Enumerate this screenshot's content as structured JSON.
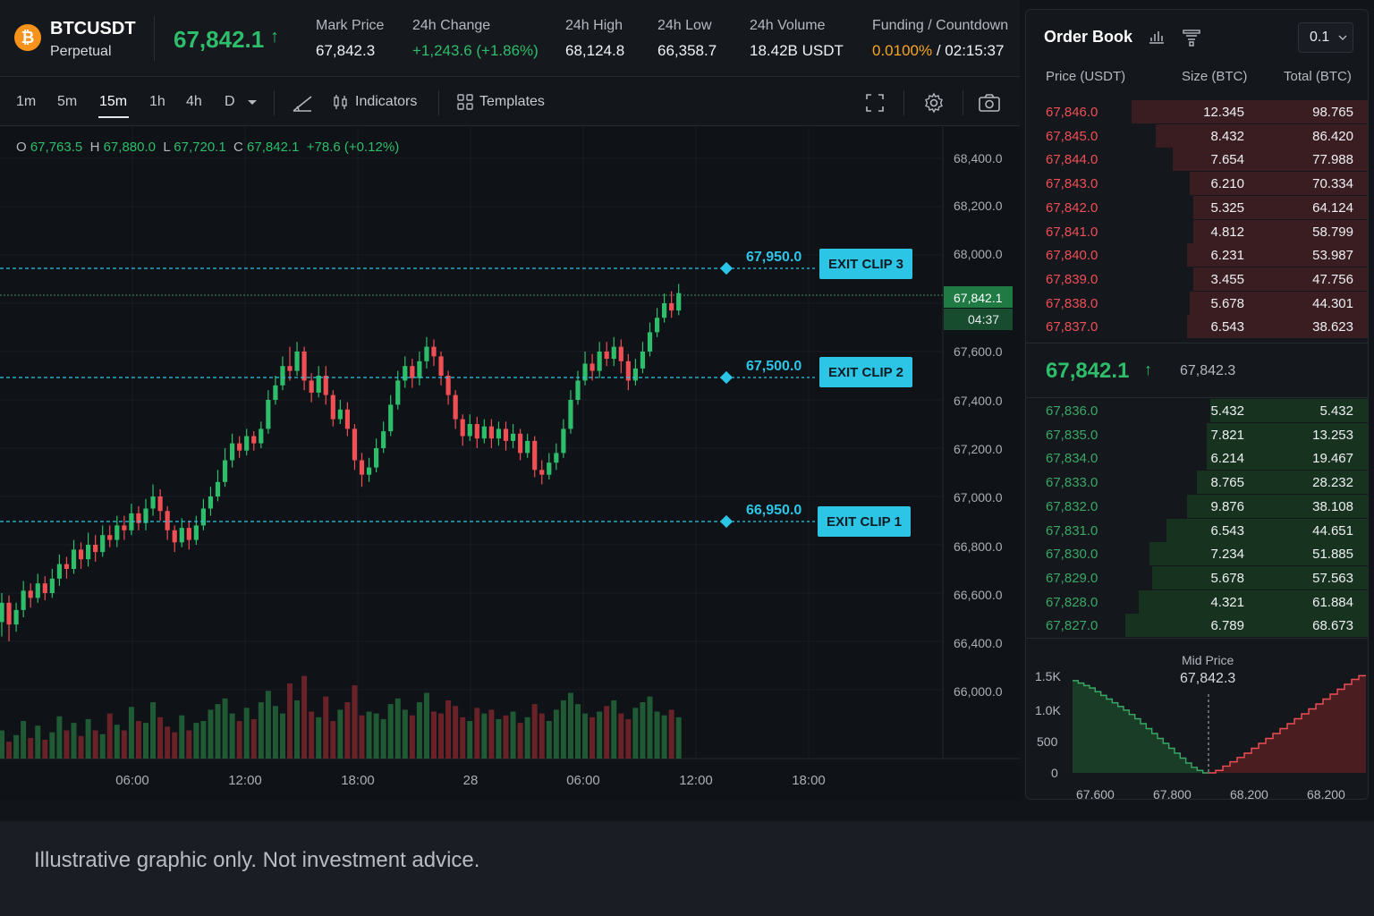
{
  "header": {
    "coin_glyph": "₿",
    "symbol": "BTCUSDT",
    "contract": "Perpetual",
    "last_price": "67,842.1",
    "arrow": "↑",
    "stats": [
      {
        "label": "Mark Price",
        "value": "67,842.3",
        "tone": "default"
      },
      {
        "label": "24h Change",
        "value": "+1,243.6 (+1.86%)",
        "tone": "green"
      },
      {
        "label": "24h High",
        "value": "68,124.8",
        "tone": "default"
      },
      {
        "label": "24h Low",
        "value": "66,358.7",
        "tone": "default"
      },
      {
        "label": "24h Volume",
        "value": "18.42B USDT",
        "tone": "default"
      }
    ],
    "funding": {
      "label": "Funding / Countdown",
      "rate": "0.0100%",
      "sep": " / ",
      "countdown": "02:15:37"
    }
  },
  "toolbar": {
    "timeframes": [
      "1m",
      "5m",
      "15m",
      "1h",
      "4h",
      "D"
    ],
    "active": "15m",
    "dropdown_icon": "caret-down-icon",
    "indicators_label": "Indicators",
    "templates_label": "Templates"
  },
  "ohlc": {
    "o_label": "O",
    "o": "67,763.5",
    "h_label": "H",
    "h": "67,880.0",
    "l_label": "L",
    "l": "67,720.1",
    "c_label": "C",
    "c": "67,842.1",
    "chg": "+78.6 (+0.12%)"
  },
  "chart": {
    "y_ticks": [
      "68,400.0",
      "68,200.0",
      "68,000.0",
      "67,600.0",
      "67,400.0",
      "67,200.0",
      "67,000.0",
      "66,800.0",
      "66,600.0",
      "66,400.0",
      "66,000.0"
    ],
    "x_ticks": [
      "06:00",
      "12:00",
      "18:00",
      "28",
      "06:00",
      "12:00",
      "18:00"
    ],
    "current_price": "67,842.1",
    "candle_countdown": "04:37",
    "exits": [
      {
        "label": "EXIT CLIP 3",
        "price": "67,950.0"
      },
      {
        "label": "EXIT CLIP 2",
        "price": "67,500.0"
      },
      {
        "label": "EXIT CLIP 1",
        "price": "66,950.0"
      }
    ],
    "colors": {
      "up": "#2ebd6b",
      "down": "#ef4f55",
      "accent": "#2dc5e6"
    }
  },
  "chart_data": {
    "type": "candlestick",
    "x_ticks": [
      "06:00",
      "12:00",
      "18:00",
      "28",
      "06:00",
      "12:00",
      "18:00"
    ],
    "candles": [
      {
        "o": 66480,
        "c": 66560,
        "h": 66600,
        "l": 66420
      },
      {
        "o": 66560,
        "c": 66470,
        "h": 66590,
        "l": 66400
      },
      {
        "o": 66470,
        "c": 66530,
        "h": 66560,
        "l": 66440
      },
      {
        "o": 66530,
        "c": 66610,
        "h": 66650,
        "l": 66500
      },
      {
        "o": 66610,
        "c": 66580,
        "h": 66640,
        "l": 66540
      },
      {
        "o": 66580,
        "c": 66640,
        "h": 66680,
        "l": 66560
      },
      {
        "o": 66640,
        "c": 66600,
        "h": 66670,
        "l": 66570
      },
      {
        "o": 66600,
        "c": 66660,
        "h": 66700,
        "l": 66580
      },
      {
        "o": 66660,
        "c": 66720,
        "h": 66760,
        "l": 66630
      },
      {
        "o": 66720,
        "c": 66700,
        "h": 66750,
        "l": 66660
      },
      {
        "o": 66700,
        "c": 66780,
        "h": 66820,
        "l": 66680
      },
      {
        "o": 66780,
        "c": 66740,
        "h": 66810,
        "l": 66700
      },
      {
        "o": 66740,
        "c": 66800,
        "h": 66850,
        "l": 66710
      },
      {
        "o": 66800,
        "c": 66770,
        "h": 66840,
        "l": 66730
      },
      {
        "o": 66770,
        "c": 66840,
        "h": 66880,
        "l": 66750
      },
      {
        "o": 66840,
        "c": 66820,
        "h": 66880,
        "l": 66790
      },
      {
        "o": 66820,
        "c": 66880,
        "h": 66920,
        "l": 66790
      },
      {
        "o": 66880,
        "c": 66860,
        "h": 66920,
        "l": 66820
      },
      {
        "o": 66860,
        "c": 66930,
        "h": 66970,
        "l": 66840
      },
      {
        "o": 66930,
        "c": 66890,
        "h": 66960,
        "l": 66860
      },
      {
        "o": 66890,
        "c": 66950,
        "h": 66990,
        "l": 66860
      },
      {
        "o": 66950,
        "c": 67000,
        "h": 67050,
        "l": 66920
      },
      {
        "o": 67000,
        "c": 66940,
        "h": 67030,
        "l": 66900
      },
      {
        "o": 66940,
        "c": 66860,
        "h": 66960,
        "l": 66820
      },
      {
        "o": 66860,
        "c": 66810,
        "h": 66880,
        "l": 66770
      },
      {
        "o": 66810,
        "c": 66870,
        "h": 66910,
        "l": 66790
      },
      {
        "o": 66870,
        "c": 66820,
        "h": 66900,
        "l": 66780
      },
      {
        "o": 66820,
        "c": 66880,
        "h": 66920,
        "l": 66800
      },
      {
        "o": 66880,
        "c": 66950,
        "h": 66990,
        "l": 66860
      },
      {
        "o": 66950,
        "c": 67000,
        "h": 67040,
        "l": 66920
      },
      {
        "o": 67000,
        "c": 67060,
        "h": 67110,
        "l": 66980
      },
      {
        "o": 67060,
        "c": 67150,
        "h": 67200,
        "l": 67040
      },
      {
        "o": 67150,
        "c": 67220,
        "h": 67260,
        "l": 67120
      },
      {
        "o": 67220,
        "c": 67190,
        "h": 67250,
        "l": 67160
      },
      {
        "o": 67190,
        "c": 67250,
        "h": 67280,
        "l": 67170
      },
      {
        "o": 67250,
        "c": 67220,
        "h": 67270,
        "l": 67190
      },
      {
        "o": 67220,
        "c": 67280,
        "h": 67310,
        "l": 67200
      },
      {
        "o": 67280,
        "c": 67400,
        "h": 67440,
        "l": 67260
      },
      {
        "o": 67400,
        "c": 67460,
        "h": 67500,
        "l": 67380
      },
      {
        "o": 67460,
        "c": 67540,
        "h": 67580,
        "l": 67440
      },
      {
        "o": 67540,
        "c": 67520,
        "h": 67620,
        "l": 67480
      },
      {
        "o": 67520,
        "c": 67600,
        "h": 67640,
        "l": 67500
      },
      {
        "o": 67600,
        "c": 67480,
        "h": 67620,
        "l": 67440
      },
      {
        "o": 67480,
        "c": 67430,
        "h": 67510,
        "l": 67390
      },
      {
        "o": 67430,
        "c": 67500,
        "h": 67540,
        "l": 67410
      },
      {
        "o": 67500,
        "c": 67420,
        "h": 67540,
        "l": 67380
      },
      {
        "o": 67420,
        "c": 67320,
        "h": 67440,
        "l": 67290
      },
      {
        "o": 67320,
        "c": 67360,
        "h": 67400,
        "l": 67300
      },
      {
        "o": 67360,
        "c": 67280,
        "h": 67390,
        "l": 67250
      },
      {
        "o": 67280,
        "c": 67150,
        "h": 67300,
        "l": 67110
      },
      {
        "o": 67150,
        "c": 67090,
        "h": 67180,
        "l": 67040
      },
      {
        "o": 67090,
        "c": 67120,
        "h": 67160,
        "l": 67060
      },
      {
        "o": 67120,
        "c": 67200,
        "h": 67240,
        "l": 67100
      },
      {
        "o": 67200,
        "c": 67270,
        "h": 67310,
        "l": 67180
      },
      {
        "o": 67270,
        "c": 67380,
        "h": 67420,
        "l": 67250
      },
      {
        "o": 67380,
        "c": 67480,
        "h": 67520,
        "l": 67360
      },
      {
        "o": 67480,
        "c": 67540,
        "h": 67580,
        "l": 67450
      },
      {
        "o": 67540,
        "c": 67490,
        "h": 67570,
        "l": 67450
      },
      {
        "o": 67490,
        "c": 67560,
        "h": 67600,
        "l": 67460
      },
      {
        "o": 67560,
        "c": 67620,
        "h": 67660,
        "l": 67530
      },
      {
        "o": 67620,
        "c": 67580,
        "h": 67650,
        "l": 67540
      },
      {
        "o": 67580,
        "c": 67500,
        "h": 67600,
        "l": 67460
      },
      {
        "o": 67500,
        "c": 67420,
        "h": 67520,
        "l": 67380
      },
      {
        "o": 67420,
        "c": 67320,
        "h": 67440,
        "l": 67280
      },
      {
        "o": 67320,
        "c": 67250,
        "h": 67340,
        "l": 67210
      },
      {
        "o": 67250,
        "c": 67300,
        "h": 67340,
        "l": 67230
      },
      {
        "o": 67300,
        "c": 67240,
        "h": 67330,
        "l": 67200
      },
      {
        "o": 67240,
        "c": 67290,
        "h": 67320,
        "l": 67220
      },
      {
        "o": 67290,
        "c": 67240,
        "h": 67320,
        "l": 67200
      },
      {
        "o": 67240,
        "c": 67280,
        "h": 67310,
        "l": 67210
      },
      {
        "o": 67280,
        "c": 67230,
        "h": 67310,
        "l": 67190
      },
      {
        "o": 67230,
        "c": 67260,
        "h": 67300,
        "l": 67200
      },
      {
        "o": 67260,
        "c": 67180,
        "h": 67280,
        "l": 67150
      },
      {
        "o": 67180,
        "c": 67230,
        "h": 67260,
        "l": 67160
      },
      {
        "o": 67230,
        "c": 67110,
        "h": 67250,
        "l": 67080
      },
      {
        "o": 67110,
        "c": 67090,
        "h": 67150,
        "l": 67050
      },
      {
        "o": 67090,
        "c": 67140,
        "h": 67180,
        "l": 67070
      },
      {
        "o": 67140,
        "c": 67180,
        "h": 67220,
        "l": 67110
      },
      {
        "o": 67180,
        "c": 67280,
        "h": 67320,
        "l": 67160
      },
      {
        "o": 67280,
        "c": 67400,
        "h": 67440,
        "l": 67260
      },
      {
        "o": 67400,
        "c": 67480,
        "h": 67520,
        "l": 67380
      },
      {
        "o": 67480,
        "c": 67550,
        "h": 67600,
        "l": 67460
      },
      {
        "o": 67550,
        "c": 67520,
        "h": 67590,
        "l": 67480
      },
      {
        "o": 67520,
        "c": 67600,
        "h": 67640,
        "l": 67490
      },
      {
        "o": 67600,
        "c": 67570,
        "h": 67640,
        "l": 67540
      },
      {
        "o": 67570,
        "c": 67620,
        "h": 67660,
        "l": 67540
      },
      {
        "o": 67620,
        "c": 67560,
        "h": 67650,
        "l": 67510
      },
      {
        "o": 67560,
        "c": 67480,
        "h": 67590,
        "l": 67440
      },
      {
        "o": 67480,
        "c": 67530,
        "h": 67570,
        "l": 67460
      },
      {
        "o": 67530,
        "c": 67600,
        "h": 67640,
        "l": 67510
      },
      {
        "o": 67600,
        "c": 67680,
        "h": 67720,
        "l": 67580
      },
      {
        "o": 67680,
        "c": 67740,
        "h": 67780,
        "l": 67660
      },
      {
        "o": 67740,
        "c": 67800,
        "h": 67840,
        "l": 67720
      },
      {
        "o": 67800,
        "c": 67770,
        "h": 67850,
        "l": 67740
      },
      {
        "o": 67770,
        "c": 67842,
        "h": 67880,
        "l": 67750
      }
    ],
    "volume": [
      30,
      18,
      25,
      40,
      22,
      35,
      20,
      28,
      45,
      30,
      38,
      24,
      42,
      30,
      26,
      48,
      36,
      30,
      55,
      40,
      38,
      60,
      44,
      34,
      28,
      46,
      30,
      38,
      40,
      52,
      58,
      64,
      48,
      40,
      54,
      42,
      60,
      72,
      56,
      48,
      80,
      62,
      88,
      50,
      44,
      66,
      40,
      52,
      60,
      78,
      46,
      50,
      48,
      42,
      58,
      64,
      52,
      46,
      60,
      70,
      50,
      48,
      62,
      56,
      44,
      40,
      54,
      48,
      52,
      42,
      46,
      50,
      38,
      44,
      58,
      48,
      40,
      52,
      62,
      70,
      58,
      48,
      44,
      50,
      56,
      62,
      48,
      42,
      54,
      60,
      66,
      50,
      46,
      52,
      44,
      20
    ],
    "y_range": [
      65900,
      68500
    ],
    "exit_levels": [
      67950,
      67500,
      66950
    ],
    "current": 67842.1
  },
  "orderbook": {
    "title": "Order Book",
    "precision": "0.1",
    "headers": {
      "price": "Price (USDT)",
      "size": "Size (BTC)",
      "total": "Total (BTC)"
    },
    "asks": [
      {
        "p": "67,846.0",
        "s": "12.345",
        "t": "98.765",
        "d": 0.69
      },
      {
        "p": "67,845.0",
        "s": "8.432",
        "t": "86.420",
        "d": 0.62
      },
      {
        "p": "67,844.0",
        "s": "7.654",
        "t": "77.988",
        "d": 0.57
      },
      {
        "p": "67,843.0",
        "s": "6.210",
        "t": "70.334",
        "d": 0.52
      },
      {
        "p": "67,842.0",
        "s": "5.325",
        "t": "64.124",
        "d": 0.51
      },
      {
        "p": "67,841.0",
        "s": "4.812",
        "t": "58.799",
        "d": 0.51
      },
      {
        "p": "67,840.0",
        "s": "6.231",
        "t": "53.987",
        "d": 0.53
      },
      {
        "p": "67,839.0",
        "s": "3.455",
        "t": "47.756",
        "d": 0.51
      },
      {
        "p": "67,838.0",
        "s": "5.678",
        "t": "44.301",
        "d": 0.52
      },
      {
        "p": "67,837.0",
        "s": "6.543",
        "t": "38.623",
        "d": 0.53
      }
    ],
    "mid": {
      "price": "67,842.1",
      "arrow": "↑",
      "mark": "67,842.3"
    },
    "bids": [
      {
        "p": "67,836.0",
        "s": "5.432",
        "t": "5.432",
        "d": 0.46
      },
      {
        "p": "67,835.0",
        "s": "7.821",
        "t": "13.253",
        "d": 0.47
      },
      {
        "p": "67,834.0",
        "s": "6.214",
        "t": "19.467",
        "d": 0.47
      },
      {
        "p": "67,833.0",
        "s": "8.765",
        "t": "28.232",
        "d": 0.5
      },
      {
        "p": "67,832.0",
        "s": "9.876",
        "t": "38.108",
        "d": 0.53
      },
      {
        "p": "67,831.0",
        "s": "6.543",
        "t": "44.651",
        "d": 0.59
      },
      {
        "p": "67,830.0",
        "s": "7.234",
        "t": "51.885",
        "d": 0.64
      },
      {
        "p": "67,829.0",
        "s": "5.678",
        "t": "57.563",
        "d": 0.63
      },
      {
        "p": "67,828.0",
        "s": "4.321",
        "t": "61.884",
        "d": 0.67
      },
      {
        "p": "67,827.0",
        "s": "6.789",
        "t": "68.673",
        "d": 0.71
      }
    ],
    "depth": {
      "y_labels": [
        "1.5K",
        "1.0K",
        "500",
        "0"
      ],
      "x_labels": [
        "67,600",
        "67,800",
        "68,200",
        "68,200"
      ],
      "mid_caption": "Mid Price",
      "mid_value": "67,842.3",
      "bid_steps": [
        1500,
        1460,
        1420,
        1380,
        1320,
        1260,
        1200,
        1140,
        1080,
        1020,
        950,
        880,
        800,
        720,
        640,
        560,
        480,
        400,
        320,
        240,
        160,
        90,
        40,
        0
      ],
      "ask_steps": [
        0,
        40,
        110,
        180,
        250,
        320,
        400,
        480,
        560,
        640,
        720,
        800,
        880,
        960,
        1040,
        1120,
        1200,
        1280,
        1360,
        1440,
        1520,
        1580
      ]
    }
  },
  "footer": {
    "disclaimer": "Illustrative graphic only. Not investment advice."
  }
}
